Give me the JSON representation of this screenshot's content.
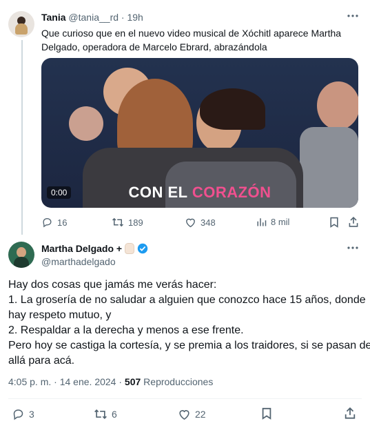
{
  "tweet1": {
    "name": "Tania",
    "handle": "@tania__rd",
    "time": "19h",
    "text_line1": "Que curioso que en el nuevo video musical de Xóchitl aparece Martha",
    "text_line2": "Delgado, operadora de Marcelo Ebrard, abrazándola",
    "video": {
      "timestamp": "0:00",
      "caption_white": "CON EL",
      "caption_pink": "CORAZÓN"
    },
    "actions": {
      "replies": "16",
      "reposts": "189",
      "likes": "348",
      "views": "8 mil"
    }
  },
  "tweet2": {
    "name": "Martha Delgado +",
    "handle": "@marthadelgado",
    "body": [
      "Hay dos cosas que jamás me verás hacer:",
      "1. La grosería de no saludar a alguien que conozco hace 15 años, donde",
      "hay respeto mutuo, y",
      "2. Respaldar a la derecha y menos a ese frente.",
      "Pero hoy se castiga la cortesía, y se premia a los traidores, si se pasan de",
      "allá para acá."
    ],
    "meta": {
      "time": "4:05 p. m.",
      "separator": "·",
      "date": "14 ene. 2024",
      "views_count": "507",
      "views_label": "Reproducciones"
    },
    "actions": {
      "replies": "3",
      "reposts": "6",
      "likes": "22"
    }
  },
  "colors": {
    "verified": "#1d9bf0",
    "pink": "#f0508f",
    "muted": "#536471"
  }
}
